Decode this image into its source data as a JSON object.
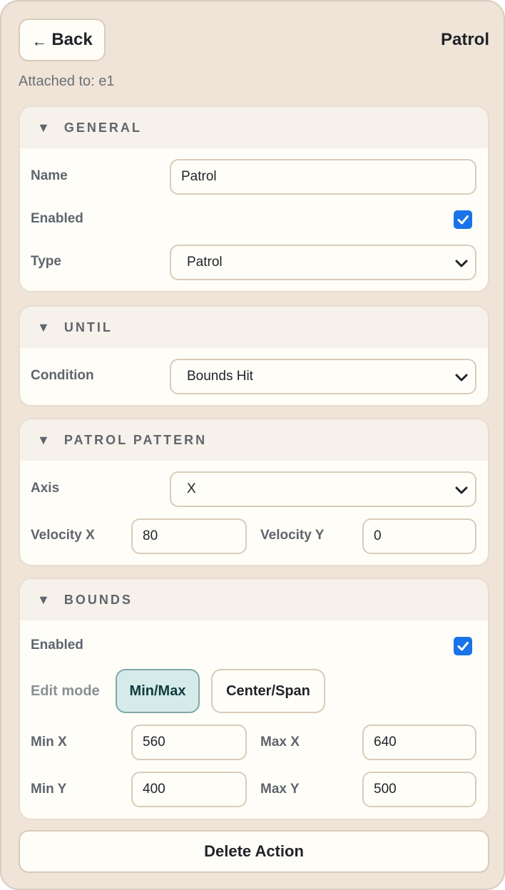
{
  "header": {
    "back_arrow": "←",
    "back_label": "Back",
    "title": "Patrol"
  },
  "attached": "Attached to: e1",
  "general": {
    "heading": "GENERAL",
    "name_label": "Name",
    "name_value": "Patrol",
    "enabled_label": "Enabled",
    "enabled_checked": true,
    "type_label": "Type",
    "type_value": "Patrol"
  },
  "until": {
    "heading": "UNTIL",
    "condition_label": "Condition",
    "condition_value": "Bounds Hit"
  },
  "patrol_pattern": {
    "heading": "PATROL PATTERN",
    "axis_label": "Axis",
    "axis_value": "X",
    "velocity_x_label": "Velocity X",
    "velocity_x_value": "80",
    "velocity_y_label": "Velocity Y",
    "velocity_y_value": "0"
  },
  "bounds": {
    "heading": "BOUNDS",
    "enabled_label": "Enabled",
    "enabled_checked": true,
    "edit_mode_label": "Edit mode",
    "mode_minmax": "Min/Max",
    "mode_centerspan": "Center/Span",
    "active_mode": "Min/Max",
    "min_x_label": "Min X",
    "min_x_value": "560",
    "max_x_label": "Max X",
    "max_x_value": "640",
    "min_y_label": "Min Y",
    "min_y_value": "400",
    "max_y_label": "Max Y",
    "max_y_value": "500"
  },
  "delete_label": "Delete Action",
  "colors": {
    "background": "#efe4d7",
    "panel": "#fffdf8",
    "checkbox": "#1a73e8",
    "active_mode": "#d5ebe9"
  }
}
